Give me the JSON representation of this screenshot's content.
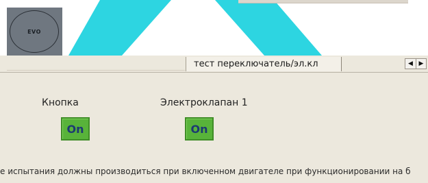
{
  "logo": {
    "text": "EVO"
  },
  "tabs": {
    "active_label": "тест переключатель/эл.кл",
    "scroll_left_glyph": "◀",
    "scroll_right_glyph": "▶"
  },
  "controls": {
    "button": {
      "label": "Кнопка",
      "state": "On"
    },
    "valve": {
      "label": "Электроклапан 1",
      "state": "On"
    }
  },
  "footer": {
    "text": "е испытания должны производиться при включенном двигателе при функционировании на б"
  },
  "colors": {
    "background_accent": "#22d3df",
    "window_bg": "#ece8dd",
    "on_button_bg": "#58b33a",
    "on_button_text": "#1c3a72"
  }
}
